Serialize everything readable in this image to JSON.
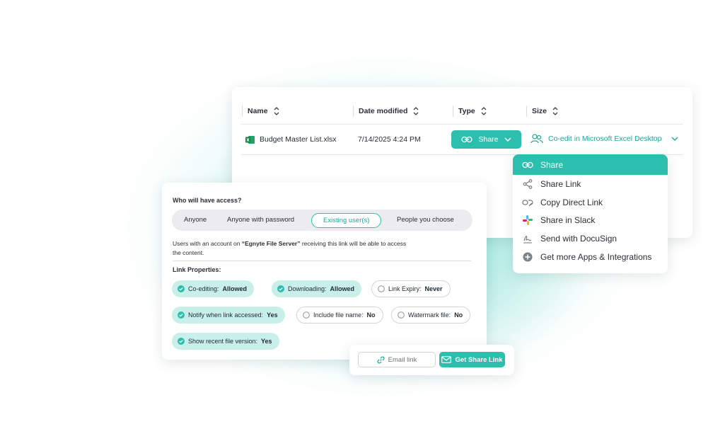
{
  "file_table": {
    "columns": [
      "Name",
      "Date modified",
      "Type",
      "Size"
    ],
    "rows": [
      {
        "name": "Budget Master List.xlsx",
        "date": "7/14/2025 4:24 PM",
        "icon": "excel-icon"
      }
    ],
    "share_button_label": "Share",
    "coedit_label": "Co-edit in Microsoft Excel Desktop"
  },
  "share_menu": {
    "items": [
      {
        "label": "Share",
        "icon": "link-icon"
      },
      {
        "label": "Share Link",
        "icon": "share-nodes-icon"
      },
      {
        "label": "Copy Direct Link",
        "icon": "copy-link-icon"
      },
      {
        "label": "Share in Slack",
        "icon": "slack-icon"
      },
      {
        "label": "Send with DocuSign",
        "icon": "signature-icon"
      },
      {
        "label": "Get more Apps & Integrations",
        "icon": "plus-circle-icon"
      }
    ]
  },
  "access": {
    "title": "Who will have access?",
    "options": [
      "Anyone",
      "Anyone with password",
      "Existing user(s)",
      "People you choose"
    ],
    "selected": "Existing user(s)",
    "desc_prefix": "Users with an account on ",
    "desc_server": "“Egnyte File Server”",
    "desc_suffix": " receiving this link will be able to access the content."
  },
  "link_properties": {
    "title": "Link Properties:",
    "items": [
      {
        "label": "Co-editing:",
        "value": "Allowed",
        "on": true
      },
      {
        "label": "Downloading:",
        "value": "Allowed",
        "on": true
      },
      {
        "label": "Link Expiry:",
        "value": "Never",
        "on": false
      },
      {
        "label": "Notify when link accessed:",
        "value": "Yes",
        "on": true
      },
      {
        "label": "Include file name:",
        "value": "No",
        "on": false
      },
      {
        "label": "Watermark file:",
        "value": "No",
        "on": false
      },
      {
        "label": "Show recent file version:",
        "value": "Yes",
        "on": true
      }
    ]
  },
  "actions": {
    "email_label": "Email link",
    "get_link_label": "Get Share Link"
  },
  "colors": {
    "accent": "#2cbfae",
    "accent_text": "#1aa89a",
    "chip_on": "#c8efea"
  }
}
